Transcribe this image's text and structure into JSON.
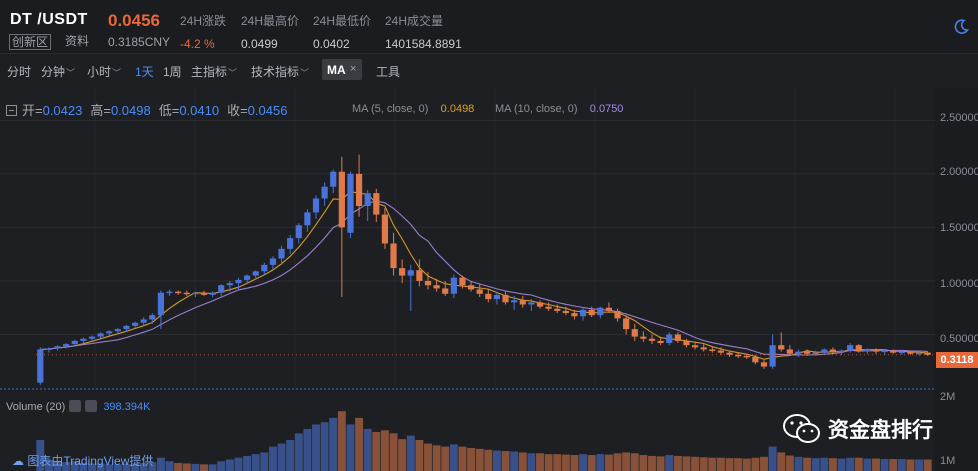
{
  "header": {
    "pair": "DT /USDT",
    "price": "0.0456",
    "tag_innovation": "创新区",
    "tag_info": "资料",
    "price_cny": "0.3185CNY",
    "stats": [
      {
        "label": "24H涨跌",
        "value": "-4.2 %",
        "negative": true
      },
      {
        "label": "24H最高价",
        "value": "0.0499",
        "negative": false
      },
      {
        "label": "24H最低价",
        "value": "0.0402",
        "negative": false
      },
      {
        "label": "24H成交量",
        "value": "1401584.8891",
        "negative": false
      }
    ],
    "theme_icon": "moon-icon"
  },
  "toolbar": {
    "items": [
      {
        "label": "分时",
        "dropdown": false,
        "active": false
      },
      {
        "label": "分钟",
        "dropdown": true,
        "active": false
      },
      {
        "label": "小时",
        "dropdown": true,
        "active": false
      },
      {
        "label": "1天",
        "dropdown": false,
        "active": true
      },
      {
        "label": "1周",
        "dropdown": false,
        "active": false
      },
      {
        "label": "主指标",
        "dropdown": true,
        "active": false
      },
      {
        "label": "技术指标",
        "dropdown": true,
        "active": false
      }
    ],
    "ma_chip": "MA",
    "ma_close": "×",
    "tools": "工具"
  },
  "legend": {
    "open_label": "开=",
    "open": "0.0423",
    "high_label": "高=",
    "high": "0.0498",
    "low_label": "低=",
    "low": "0.0410",
    "close_label": "收=",
    "close": "0.0456",
    "ma5_label": "MA (5, close, 0)",
    "ma5_value": "0.0498",
    "ma10_label": "MA (10, close, 0)",
    "ma10_value": "0.0750"
  },
  "volume": {
    "label": "Volume (20)",
    "value": "398.394K"
  },
  "credit": "图表由TradingView提供",
  "watermark": "资金盘排行",
  "colors": {
    "up": "#4a73d9",
    "down": "#e07a4a",
    "ma5": "#d49a26",
    "ma10": "#9a7fd0",
    "accent": "#4a8df8",
    "price_tag": "#e8683a"
  },
  "chart_data": {
    "type": "candlestick",
    "y_axis_ticks": [
      "2.50000",
      "2.00000",
      "1.50000",
      "1.00000",
      "0.50000"
    ],
    "volume_axis_ticks": [
      "2M",
      "1M"
    ],
    "ylim": [
      0,
      2.55
    ],
    "last_price_label": "0.3118",
    "candles": [
      [
        0.05,
        0.38,
        0.03,
        0.36,
        0.7
      ],
      [
        0.36,
        0.38,
        0.33,
        0.37,
        0.25
      ],
      [
        0.37,
        0.4,
        0.35,
        0.39,
        0.22
      ],
      [
        0.39,
        0.42,
        0.37,
        0.41,
        0.2
      ],
      [
        0.41,
        0.45,
        0.4,
        0.44,
        0.22
      ],
      [
        0.44,
        0.47,
        0.42,
        0.46,
        0.18
      ],
      [
        0.46,
        0.49,
        0.44,
        0.48,
        0.17
      ],
      [
        0.48,
        0.52,
        0.46,
        0.51,
        0.17
      ],
      [
        0.51,
        0.54,
        0.49,
        0.53,
        0.15
      ],
      [
        0.53,
        0.56,
        0.5,
        0.55,
        0.15
      ],
      [
        0.55,
        0.59,
        0.53,
        0.58,
        0.16
      ],
      [
        0.58,
        0.62,
        0.56,
        0.61,
        0.17
      ],
      [
        0.61,
        0.66,
        0.58,
        0.64,
        0.18
      ],
      [
        0.64,
        0.7,
        0.6,
        0.68,
        0.2
      ],
      [
        0.68,
        0.91,
        0.55,
        0.89,
        0.3
      ],
      [
        0.89,
        0.92,
        0.86,
        0.9,
        0.22
      ],
      [
        0.9,
        0.91,
        0.87,
        0.89,
        0.18
      ],
      [
        0.89,
        0.91,
        0.86,
        0.88,
        0.17
      ],
      [
        0.88,
        0.9,
        0.85,
        0.89,
        0.16
      ],
      [
        0.89,
        0.91,
        0.86,
        0.87,
        0.15
      ],
      [
        0.87,
        0.9,
        0.85,
        0.89,
        0.15
      ],
      [
        0.89,
        0.97,
        0.86,
        0.96,
        0.22
      ],
      [
        0.96,
        1.0,
        0.9,
        0.98,
        0.26
      ],
      [
        0.98,
        1.03,
        0.92,
        1.01,
        0.3
      ],
      [
        1.01,
        1.06,
        0.97,
        1.05,
        0.34
      ],
      [
        1.05,
        1.1,
        1.01,
        1.09,
        0.38
      ],
      [
        1.09,
        1.17,
        1.05,
        1.15,
        0.42
      ],
      [
        1.15,
        1.23,
        1.1,
        1.21,
        0.55
      ],
      [
        1.21,
        1.33,
        1.15,
        1.3,
        0.62
      ],
      [
        1.3,
        1.43,
        1.25,
        1.4,
        0.7
      ],
      [
        1.4,
        1.54,
        1.35,
        1.52,
        0.85
      ],
      [
        1.52,
        1.67,
        1.46,
        1.64,
        0.95
      ],
      [
        1.64,
        1.8,
        1.58,
        1.77,
        1.05
      ],
      [
        1.77,
        1.92,
        1.7,
        1.88,
        1.1
      ],
      [
        1.88,
        2.04,
        1.82,
        2.02,
        1.2
      ],
      [
        2.02,
        2.16,
        0.85,
        1.5,
        1.35
      ],
      [
        1.45,
        2.02,
        1.4,
        2.0,
        1.05
      ],
      [
        2.0,
        2.18,
        1.6,
        1.7,
        1.2
      ],
      [
        1.7,
        1.85,
        1.56,
        1.82,
        0.95
      ],
      [
        1.82,
        1.86,
        1.55,
        1.62,
        0.88
      ],
      [
        1.62,
        1.68,
        1.3,
        1.35,
        0.92
      ],
      [
        1.35,
        1.45,
        1.05,
        1.12,
        0.85
      ],
      [
        1.12,
        1.2,
        0.98,
        1.05,
        0.72
      ],
      [
        1.05,
        1.15,
        0.72,
        1.1,
        0.8
      ],
      [
        1.1,
        1.2,
        0.95,
        1.0,
        0.7
      ],
      [
        1.0,
        1.08,
        0.92,
        0.96,
        0.62
      ],
      [
        0.96,
        1.02,
        0.9,
        0.93,
        0.58
      ],
      [
        0.93,
        1.0,
        0.86,
        0.88,
        0.55
      ],
      [
        0.88,
        1.06,
        0.84,
        1.03,
        0.6
      ],
      [
        1.03,
        1.05,
        0.93,
        0.96,
        0.55
      ],
      [
        0.96,
        1.0,
        0.9,
        0.92,
        0.52
      ],
      [
        0.92,
        0.97,
        0.85,
        0.88,
        0.5
      ],
      [
        0.88,
        0.92,
        0.8,
        0.83,
        0.48
      ],
      [
        0.83,
        0.9,
        0.78,
        0.87,
        0.46
      ],
      [
        0.87,
        0.9,
        0.78,
        0.8,
        0.45
      ],
      [
        0.8,
        0.86,
        0.73,
        0.82,
        0.44
      ],
      [
        0.82,
        0.86,
        0.75,
        0.78,
        0.42
      ],
      [
        0.78,
        0.83,
        0.72,
        0.8,
        0.4
      ],
      [
        0.8,
        0.82,
        0.74,
        0.76,
        0.4
      ],
      [
        0.76,
        0.8,
        0.72,
        0.74,
        0.38
      ],
      [
        0.74,
        0.78,
        0.7,
        0.72,
        0.38
      ],
      [
        0.72,
        0.76,
        0.68,
        0.7,
        0.37
      ],
      [
        0.7,
        0.73,
        0.64,
        0.67,
        0.36
      ],
      [
        0.67,
        0.75,
        0.63,
        0.73,
        0.38
      ],
      [
        0.73,
        0.76,
        0.66,
        0.68,
        0.36
      ],
      [
        0.68,
        0.76,
        0.65,
        0.75,
        0.38
      ],
      [
        0.75,
        0.8,
        0.7,
        0.72,
        0.37
      ],
      [
        0.72,
        0.74,
        0.62,
        0.65,
        0.4
      ],
      [
        0.65,
        0.68,
        0.5,
        0.55,
        0.42
      ],
      [
        0.55,
        0.6,
        0.44,
        0.48,
        0.4
      ],
      [
        0.48,
        0.53,
        0.43,
        0.46,
        0.36
      ],
      [
        0.46,
        0.5,
        0.41,
        0.44,
        0.34
      ],
      [
        0.44,
        0.48,
        0.4,
        0.42,
        0.33
      ],
      [
        0.42,
        0.52,
        0.4,
        0.5,
        0.36
      ],
      [
        0.5,
        0.52,
        0.42,
        0.44,
        0.34
      ],
      [
        0.44,
        0.46,
        0.38,
        0.4,
        0.33
      ],
      [
        0.4,
        0.43,
        0.36,
        0.38,
        0.32
      ],
      [
        0.38,
        0.41,
        0.34,
        0.36,
        0.31
      ],
      [
        0.36,
        0.39,
        0.33,
        0.35,
        0.3
      ],
      [
        0.35,
        0.38,
        0.31,
        0.33,
        0.3
      ],
      [
        0.33,
        0.35,
        0.29,
        0.31,
        0.29
      ],
      [
        0.31,
        0.33,
        0.28,
        0.3,
        0.29
      ],
      [
        0.3,
        0.32,
        0.27,
        0.29,
        0.28
      ],
      [
        0.29,
        0.31,
        0.22,
        0.24,
        0.3
      ],
      [
        0.24,
        0.26,
        0.18,
        0.2,
        0.32
      ],
      [
        0.2,
        0.5,
        0.18,
        0.4,
        0.55
      ],
      [
        0.4,
        0.52,
        0.34,
        0.36,
        0.42
      ],
      [
        0.36,
        0.4,
        0.3,
        0.32,
        0.35
      ],
      [
        0.32,
        0.36,
        0.29,
        0.34,
        0.32
      ],
      [
        0.34,
        0.36,
        0.3,
        0.32,
        0.3
      ],
      [
        0.32,
        0.35,
        0.3,
        0.33,
        0.29
      ],
      [
        0.33,
        0.37,
        0.31,
        0.36,
        0.3
      ],
      [
        0.36,
        0.38,
        0.32,
        0.34,
        0.29
      ],
      [
        0.34,
        0.36,
        0.31,
        0.35,
        0.28
      ],
      [
        0.35,
        0.42,
        0.33,
        0.4,
        0.3
      ],
      [
        0.4,
        0.41,
        0.33,
        0.34,
        0.3
      ],
      [
        0.34,
        0.37,
        0.32,
        0.36,
        0.28
      ],
      [
        0.36,
        0.37,
        0.32,
        0.34,
        0.28
      ],
      [
        0.34,
        0.36,
        0.31,
        0.35,
        0.27
      ],
      [
        0.35,
        0.36,
        0.32,
        0.33,
        0.27
      ],
      [
        0.33,
        0.35,
        0.31,
        0.34,
        0.27
      ],
      [
        0.34,
        0.35,
        0.31,
        0.32,
        0.26
      ],
      [
        0.32,
        0.34,
        0.3,
        0.33,
        0.26
      ],
      [
        0.33,
        0.34,
        0.3,
        0.31,
        0.26
      ]
    ]
  }
}
